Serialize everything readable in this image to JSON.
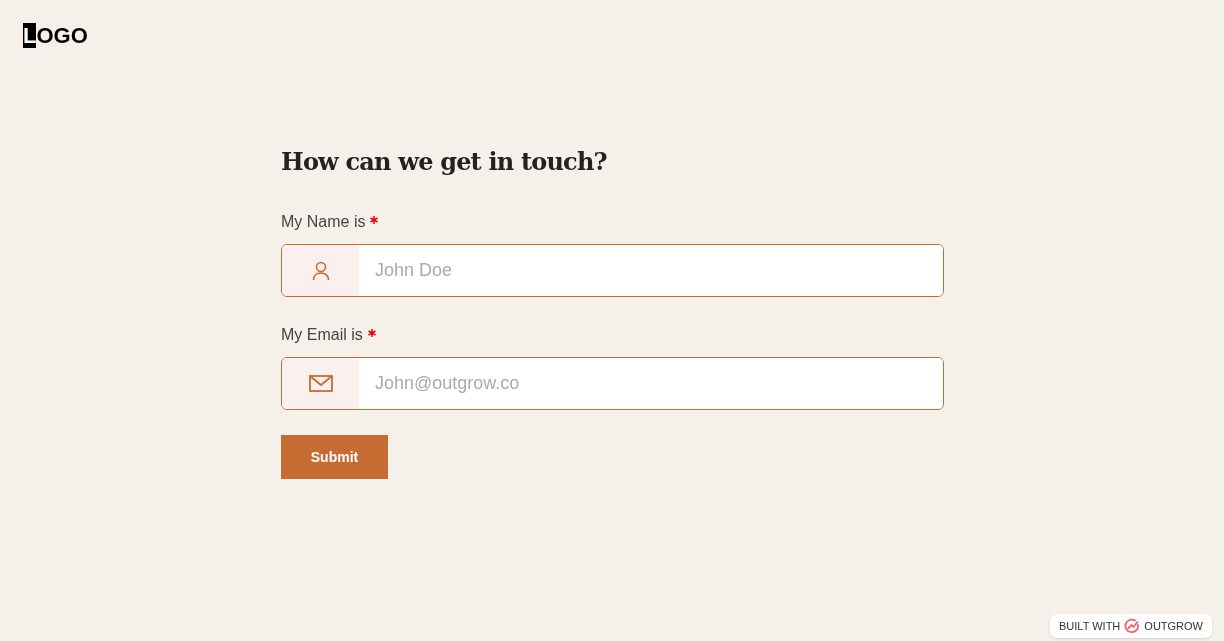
{
  "logo": "LOGO",
  "form": {
    "title": "How can we get in touch?",
    "fields": [
      {
        "kind": "name",
        "label": "My Name is",
        "required": true,
        "placeholder": "John Doe"
      },
      {
        "kind": "email",
        "label": "My Email is",
        "required": true,
        "placeholder": "John@outgrow.co"
      }
    ],
    "submit": "Submit"
  },
  "badge": {
    "prefix": "BUILT WITH",
    "brand": "OUTGROW"
  }
}
